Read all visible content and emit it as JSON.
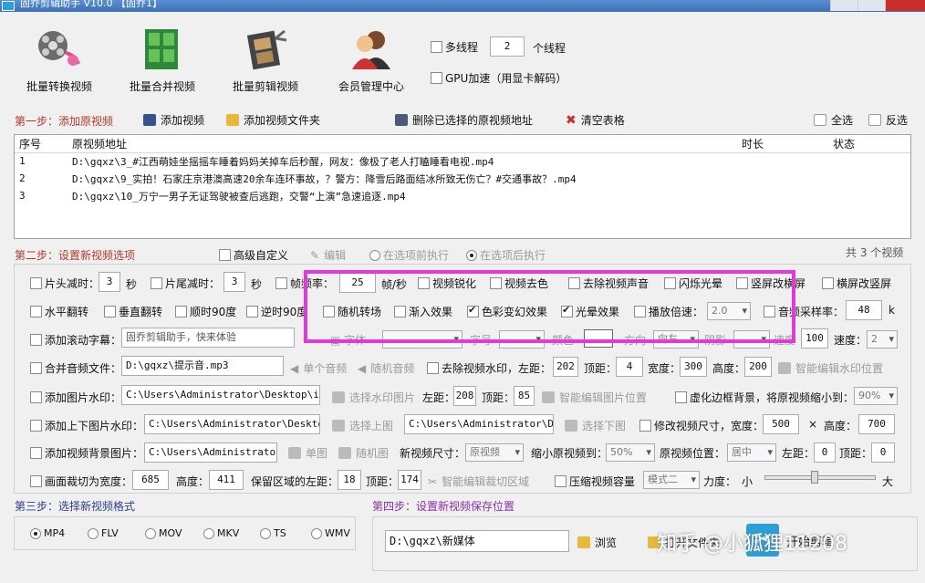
{
  "window": {
    "title": "固乔剪辑助手 V10.0 【固乔1】"
  },
  "toolbar": {
    "convert": "批量转换视频",
    "merge": "批量合并视频",
    "clip": "批量剪辑视频",
    "member": "会员管理中心",
    "multithread": "多线程",
    "threads": "2",
    "threads_unit": "个线程",
    "gpu": "GPU加速（用显卡解码）"
  },
  "step1": {
    "title": "第一步：添加原视频",
    "add_video": "添加视频",
    "add_folder": "添加视频文件夹",
    "delete_selected": "删除已选择的原视频地址",
    "clear": "清空表格",
    "select_all": "全选",
    "invert": "反选",
    "columns": [
      "序号",
      "原视频地址",
      "时长",
      "状态"
    ],
    "rows": [
      {
        "no": "1",
        "path": "D:\\gqxz\\3_#江西萌娃坐摇摇车睡着妈妈关掉车后秒醒，网友：像极了老人打瞌睡看电视.mp4",
        "duration": "",
        "status": ""
      },
      {
        "no": "2",
        "path": "D:\\gqxz\\9_实拍！石家庄京港澳高速20余车连环事故，？警方：降雪后路面结冰所致无伤亡？#交通事故？.mp4",
        "duration": "",
        "status": ""
      },
      {
        "no": "3",
        "path": "D:\\gqxz\\10_万宁一男子无证驾驶被查后逃跑，交警“上演”急速追逐.mp4",
        "duration": "",
        "status": ""
      }
    ]
  },
  "step2": {
    "title": "第二步：设置新视频选项",
    "advanced": "高级自定义",
    "edit": "编辑",
    "before": "在选项前执行",
    "after": "在选项后执行",
    "count": "共 3 个视频",
    "row1": {
      "head_cut": "片头减时：",
      "head_val": "3",
      "sec": "秒",
      "tail_cut": "片尾减时：",
      "tail_val": "3",
      "frame_rate": "帧频率：",
      "frame_val": "25",
      "frame_unit": "帧/秒",
      "sharpen": "视频锐化",
      "decolor": "视频去色",
      "remove_audio": "去除视频声音",
      "flash": "闪烁光晕",
      "h2v": "竖屏改横屏",
      "v2h": "横屏改竖屏"
    },
    "row2": {
      "hflip": "水平翻转",
      "vflip": "垂直翻转",
      "cw90": "顺时90度",
      "ccw90": "逆时90度",
      "rand_trans": "随机转场",
      "fade_in": "渐入效果",
      "color_fx": "色彩变幻效果",
      "halo": "光晕效果",
      "speed": "播放倍速：",
      "speed_val": "2.0",
      "sample": "音频采样率：",
      "sample_val": "48",
      "sample_unit": "k"
    },
    "row3": {
      "scroll_sub": "添加滚动字幕：",
      "scroll_text": "固乔剪辑助手，快来体验",
      "font": "字体",
      "size": "字号",
      "color": "颜色",
      "dir": "方向",
      "dir_val": "向左",
      "shadow": "阴影",
      "speed_lbl": "速度",
      "speed_num": "100",
      "speed2": "速度：",
      "speed2_val": "2"
    },
    "row4": {
      "merge_audio": "合并音频文件：",
      "audio_path": "D:\\gqxz\\提示音.mp3",
      "single": "单个音频",
      "random": "随机音频",
      "rm_watermark": "去除视频水印，左距：",
      "left": "202",
      "top_lbl": "顶距：",
      "top": "4",
      "width_lbl": "宽度：",
      "width": "300",
      "height_lbl": "高度：",
      "height": "200",
      "smart": "智能编辑水印位置"
    },
    "row5": {
      "img_watermark": "添加图片水印：",
      "img_path": "C:\\Users\\Administrator\\Desktop\\img-q",
      "choose": "选择水印图片",
      "left_lbl": "左距：",
      "left": "208",
      "top_lbl": "顶距：",
      "top": "85",
      "smart": "智能编辑图片位置",
      "blur": "虚化边框背景，将原视频缩小到：",
      "blur_val": "90%"
    },
    "row6": {
      "updown": "添加上下图片水印：",
      "up_path": "C:\\Users\\Administrator\\Desktop\\i",
      "choose_up": "选择上图",
      "down_path": "C:\\Users\\Administrator\\Desk",
      "choose_down": "选择下图",
      "resize": "修改视频尺寸，宽度：",
      "w": "500",
      "x": "×",
      "h_lbl": "高度：",
      "h": "700"
    },
    "row7": {
      "bg": "添加视频背景图片：",
      "bg_path": "C:\\Users\\Administrator\\I",
      "single": "单图",
      "random": "随机图",
      "new_size": "新视频尺寸：",
      "size_val": "原视频",
      "shrink": "缩小原视频到：",
      "shrink_val": "50%",
      "pos": "原视频位置：",
      "pos_val": "居中",
      "left_lbl": "左距：",
      "left": "0",
      "top_lbl": "顶距：",
      "top": "0"
    },
    "row8": {
      "crop": "画面裁切为宽度：",
      "crop_w": "685",
      "h_lbl": "高度：",
      "crop_h": "411",
      "keep": "保留区域的左距：",
      "keep_left": "18",
      "top_lbl": "顶距：",
      "keep_top": "174",
      "smart": "智能编辑裁切区域",
      "compress": "压缩视频容量",
      "mode": "模式二",
      "force": "力度：",
      "small": "小",
      "large": "大",
      "force_level": 0.45
    }
  },
  "step3": {
    "title": "第三步：选择新视频格式",
    "formats": [
      "MP4",
      "FLV",
      "MOV",
      "MKV",
      "TS",
      "WMV"
    ],
    "selected": "MP4"
  },
  "step4": {
    "title": "第四步：设置新视频保存位置",
    "path": "D:\\gqxz\\新媒体",
    "browse": "浏览",
    "open_folder": "打开文件夹",
    "start": "开始剪辑"
  },
  "watermark": "知乎 @小狐狸11208"
}
